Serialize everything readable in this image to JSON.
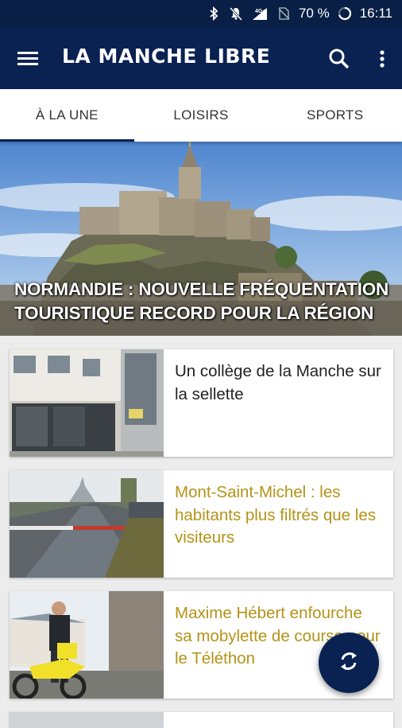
{
  "status_bar": {
    "network": "4G+",
    "battery": "70 %",
    "time": "16:11"
  },
  "app_bar": {
    "title": "LA MANCHE LIBRE"
  },
  "tabs": [
    {
      "label": "À LA UNE",
      "active": true
    },
    {
      "label": "LOISIRS",
      "active": false
    },
    {
      "label": "SPORTS",
      "active": false
    }
  ],
  "hero": {
    "headline": "NORMANDIE : NOUVELLE FRÉQUENTATION TOURISTIQUE RECORD POUR LA RÉGION"
  },
  "articles": [
    {
      "title": "Un collège de la Manche sur la sellette"
    },
    {
      "title": "Mont-Saint-Michel : les habitants plus filtrés que les visiteurs"
    },
    {
      "title": "Maxime Hébert enfourche sa mobylette de course pour le Téléthon"
    }
  ],
  "colors": {
    "brand": "#0a2252",
    "status_bar": "#091f45",
    "gold_title": "#b39317"
  }
}
